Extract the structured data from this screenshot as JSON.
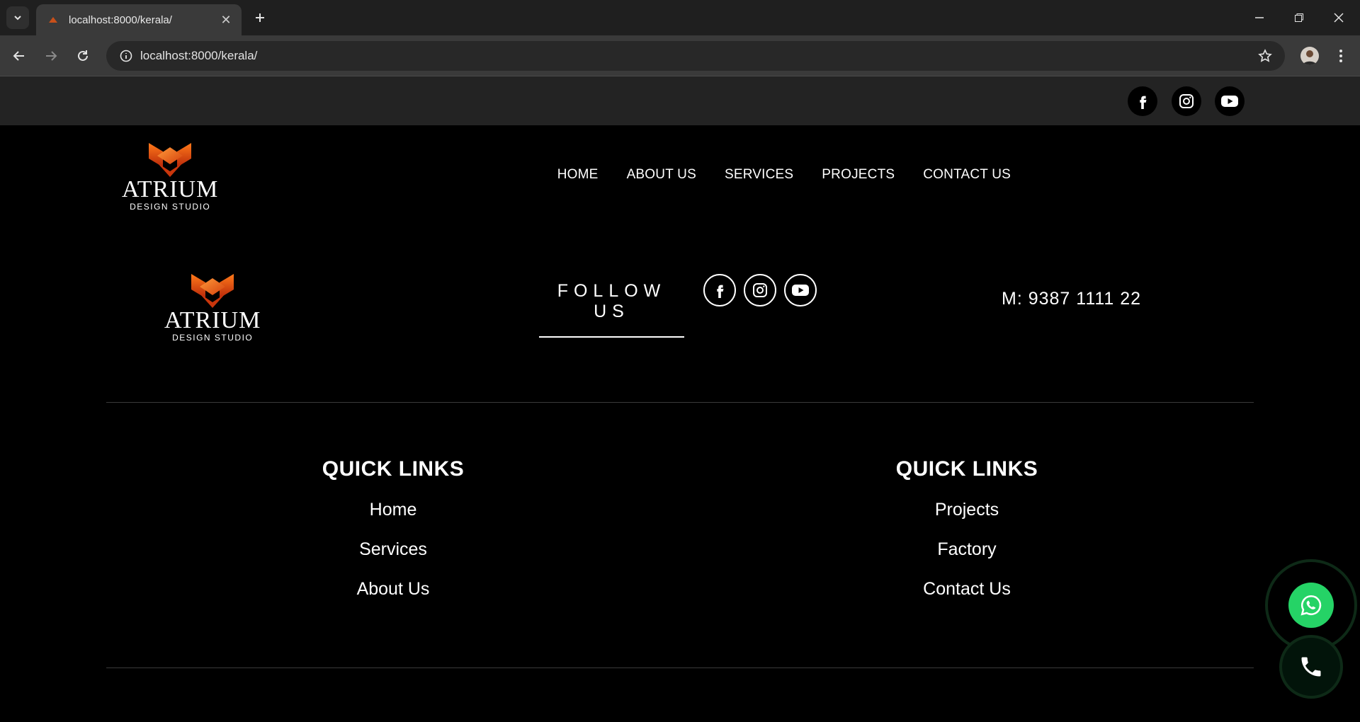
{
  "browser": {
    "tab_title": "localhost:8000/kerala/",
    "url": "localhost:8000/kerala/"
  },
  "header": {
    "social_icons": [
      "facebook-icon",
      "instagram-icon",
      "youtube-icon"
    ],
    "logo": {
      "name": "ATRIUM",
      "sub": "DESIGN STUDIO"
    },
    "nav": [
      "HOME",
      "ABOUT US",
      "SERVICES",
      "PROJECTS",
      "CONTACT US"
    ]
  },
  "footer": {
    "logo": {
      "name": "ATRIUM",
      "sub": "DESIGN STUDIO"
    },
    "follow_label": "FOLLOW US",
    "phone": "M: 9387 1111 22",
    "quick_links_left": {
      "title": "QUICK LINKS",
      "links": [
        "Home",
        "Services",
        "About Us"
      ]
    },
    "quick_links_right": {
      "title": "QUICK LINKS",
      "links": [
        "Projects",
        "Factory",
        "Contact Us"
      ]
    }
  },
  "colors": {
    "whatsapp": "#25d366",
    "strip": "#232323",
    "logo_orange": "#e85a0f"
  }
}
